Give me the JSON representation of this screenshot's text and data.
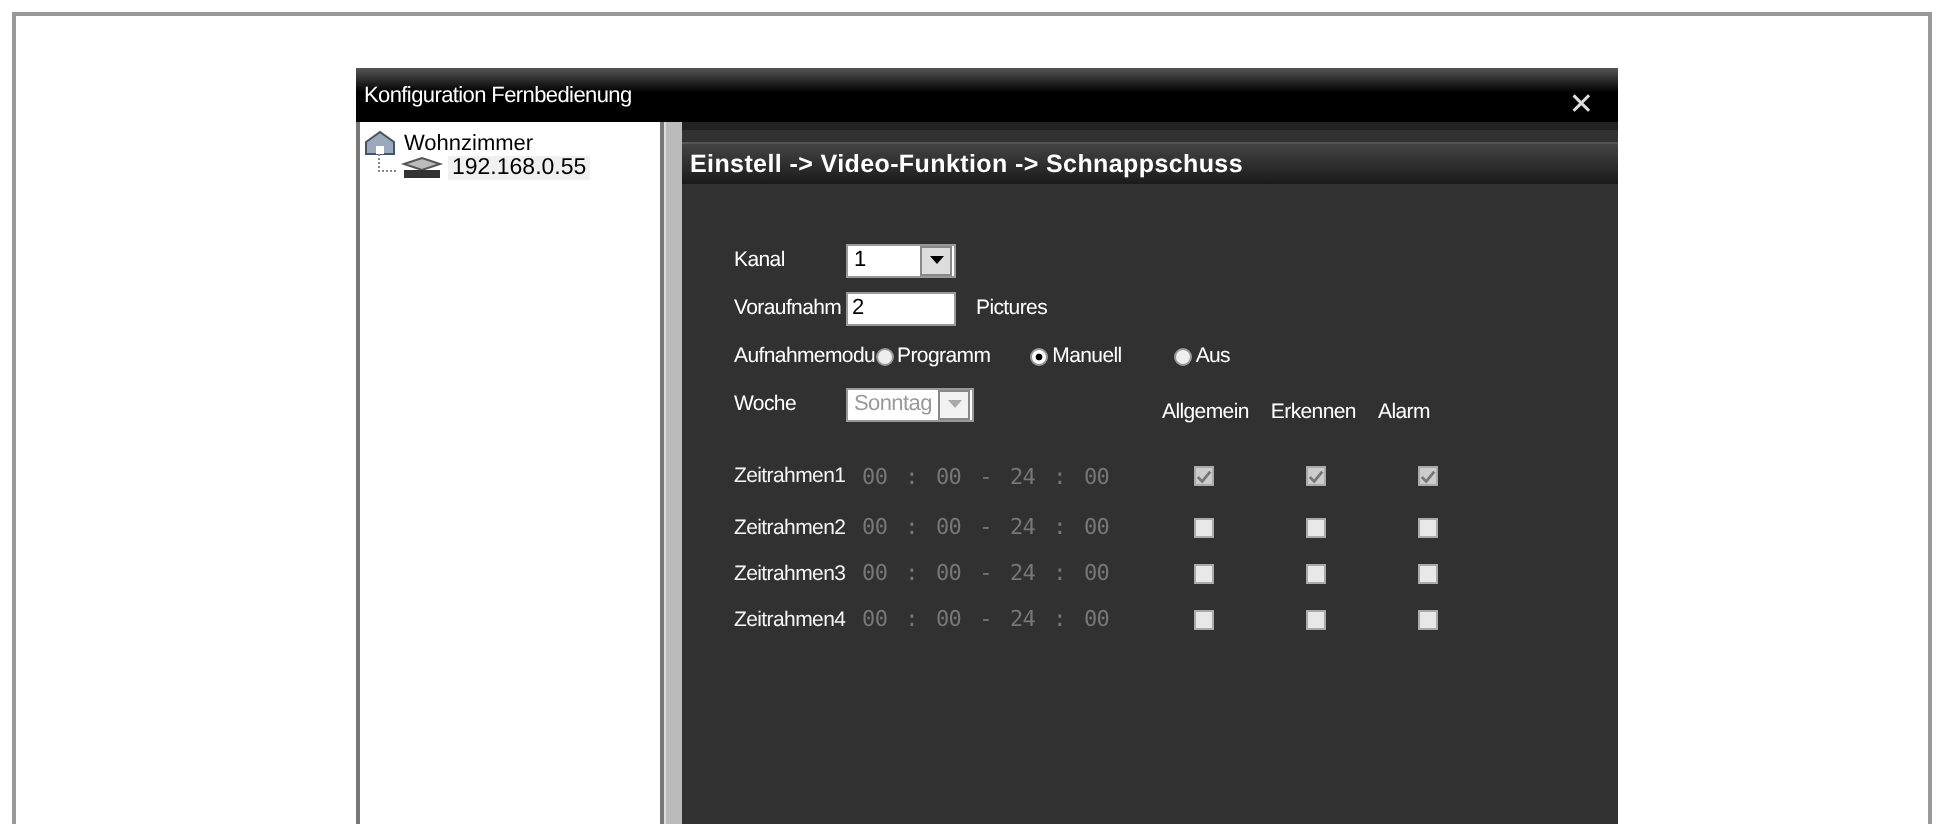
{
  "window": {
    "title": "Konfiguration Fernbedienung",
    "close": "✕"
  },
  "tree": {
    "label": "Wohnzimmer",
    "children": [
      {
        "label": "192.168.0.55",
        "selected": true
      }
    ]
  },
  "header": "Einstell -> Video-Funktion -> Schnappschuss",
  "form": {
    "kanal_label": "Kanal",
    "kanal_value": "1",
    "pre_label": "Voraufnahm",
    "pre_value": "2",
    "pre_unit": "Pictures",
    "mode_label": "Aufnahmemodu",
    "modes": [
      {
        "label": "Programm",
        "selected": false
      },
      {
        "label": "Manuell",
        "selected": true
      },
      {
        "label": "Aus",
        "selected": false
      }
    ],
    "week_label": "Woche",
    "week_value": "Sonntag",
    "week_disabled": true
  },
  "columns": [
    "Allgemein",
    "Erkennen",
    "Alarm"
  ],
  "slots": [
    {
      "label": "Zeitrahmen1",
      "time": [
        "00",
        ":",
        "00",
        "-",
        "24",
        ":",
        "00"
      ],
      "checks": [
        true,
        true,
        true
      ]
    },
    {
      "label": "Zeitrahmen2",
      "time": [
        "00",
        ":",
        "00",
        "-",
        "24",
        ":",
        "00"
      ],
      "checks": [
        false,
        false,
        false
      ]
    },
    {
      "label": "Zeitrahmen3",
      "time": [
        "00",
        ":",
        "00",
        "-",
        "24",
        ":",
        "00"
      ],
      "checks": [
        false,
        false,
        false
      ]
    },
    {
      "label": "Zeitrahmen4",
      "time": [
        "00",
        ":",
        "00",
        "-",
        "24",
        ":",
        "00"
      ],
      "checks": [
        false,
        false,
        false
      ]
    }
  ]
}
